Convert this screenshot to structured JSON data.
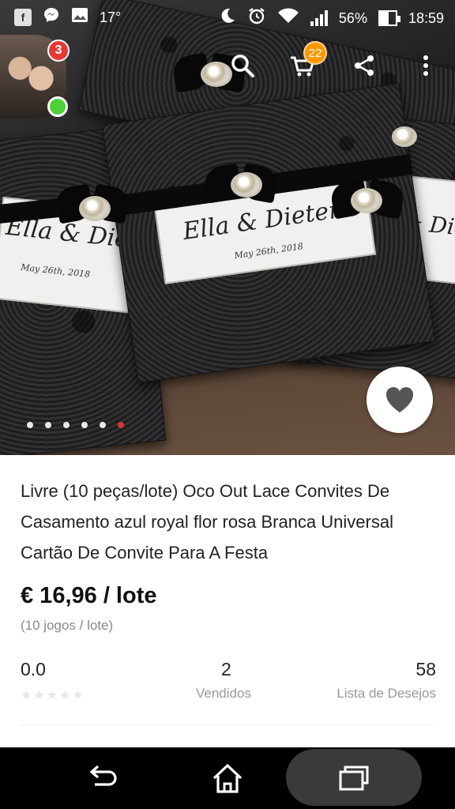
{
  "status_bar": {
    "temperature": "17°",
    "battery": "56%",
    "battery_level": 0.56,
    "time": "18:59",
    "icons": [
      "facebook-icon",
      "messenger-icon",
      "gallery-icon",
      "moon-icon",
      "alarm-icon",
      "wifi-icon",
      "signal-icon",
      "battery-icon"
    ]
  },
  "chat_head": {
    "badge_count": "3"
  },
  "top_actions": {
    "cart_count": "22",
    "icons": [
      "search-icon",
      "cart-icon",
      "share-icon",
      "more-icon"
    ]
  },
  "product_image": {
    "card_text_names": "Ella & Dieter",
    "card_text_date": "May 26th, 2018",
    "carousel_total": 6,
    "carousel_active": 6
  },
  "product": {
    "title": "Livre (10 peças/lote) Oco Out Lace Convites De Casamento azul royal flor rosa Branca Universal Cartão De Convite Para A Festa",
    "price": "€ 16,96 / lote",
    "per_lot": "(10 jogos / lote)"
  },
  "stats": {
    "rating": "0.0",
    "rating_stars": 0,
    "sold_count": "2",
    "sold_label": "Vendidos",
    "wishlist_count": "58",
    "wishlist_label": "Lista de Desejos"
  },
  "nav_bar": {
    "icons": [
      "back-icon",
      "home-icon",
      "recents-icon"
    ]
  },
  "colors": {
    "accent_red": "#e53935",
    "cart_badge": "#ff9800",
    "online_green": "#4cd137"
  }
}
